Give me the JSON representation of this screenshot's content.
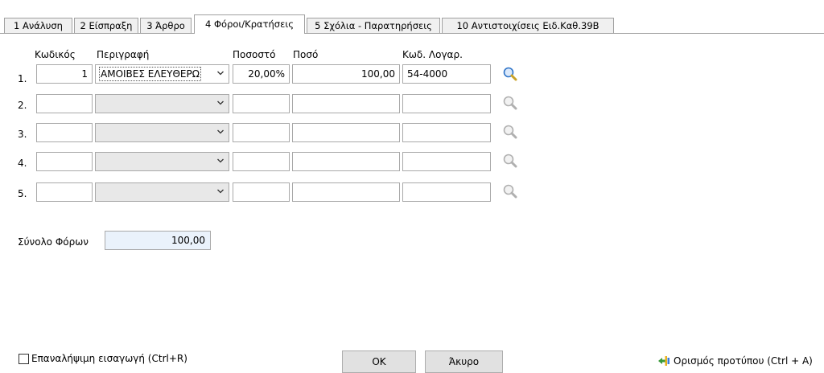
{
  "tabs": [
    {
      "label": "1 Ανάλυση",
      "active": false
    },
    {
      "label": "2 Είσπραξη",
      "active": false
    },
    {
      "label": "3 Άρθρο",
      "active": false
    },
    {
      "label": "4 Φόροι/Κρατήσεις",
      "active": true
    },
    {
      "label": "5 Σχόλια - Παρατηρήσεις",
      "active": false
    },
    {
      "label": "10 Αντιστοιχίσεις Ειδ.Καθ.39Β",
      "active": false
    }
  ],
  "columns": {
    "code": "Κωδικός",
    "description": "Περιγραφή",
    "percent": "Ποσοστό",
    "amount": "Ποσό",
    "account": "Κωδ. Λογαρ."
  },
  "rows": [
    {
      "label": "1.",
      "code": "1",
      "description": "ΑΜΟΙΒΕΣ ΕΛΕΥΘΕΡΩ",
      "percent": "20,00%",
      "amount": "100,00",
      "account": "54-4000"
    },
    {
      "label": "2.",
      "code": "",
      "description": "",
      "percent": "",
      "amount": "",
      "account": ""
    },
    {
      "label": "3.",
      "code": "",
      "description": "",
      "percent": "",
      "amount": "",
      "account": ""
    },
    {
      "label": "4.",
      "code": "",
      "description": "",
      "percent": "",
      "amount": "",
      "account": ""
    },
    {
      "label": "5.",
      "code": "",
      "description": "",
      "percent": "",
      "amount": "",
      "account": ""
    }
  ],
  "totals": {
    "label": "Σύνολο Φόρων",
    "value": "100,00"
  },
  "footer": {
    "repeat_label": "Επαναλήψιμη εισαγωγή (Ctrl+R)",
    "repeat_checked": false,
    "ok_label": "OK",
    "cancel_label": "Άκυρο",
    "template_label": "Ορισμός προτύπου (Ctrl + A)"
  },
  "icons": {
    "lookup": "magnifier-icon",
    "dropdown": "chevron-down-icon",
    "template": "template-icon"
  },
  "colors": {
    "magnifier_active": "#2f74c8",
    "magnifier_inactive": "#b0b0b0",
    "total_bg": "#eaf2fb"
  }
}
